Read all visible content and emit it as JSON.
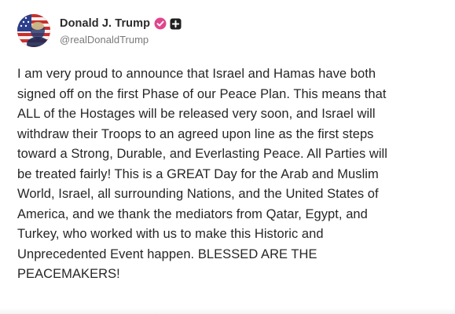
{
  "post": {
    "author": {
      "display_name": "Donald J. Trump",
      "handle": "@realDonaldTrump",
      "avatar_icon": "flag-portrait-avatar",
      "verified_icon": "verified-badge-icon",
      "verified_color": "#e0458f",
      "action_icon": "plus-square-icon"
    },
    "text_lines": [
      "I am very proud to announce that Israel and Hamas have both",
      "signed off on the first Phase of our Peace Plan. This means that",
      "ALL of the Hostages will be released very soon, and Israel will",
      "withdraw their Troops to an agreed upon line as the first steps",
      "toward a Strong, Durable, and Everlasting Peace. All Parties will",
      "be treated fairly! This is a GREAT Day for the Arab and Muslim",
      "World, Israel, all surrounding Nations, and the United States of",
      "America, and we thank the mediators from Qatar, Egypt, and",
      "Turkey, who worked with us to make this Historic and",
      "Unprecedented Event happen. BLESSED ARE THE",
      "PEACEMAKERS!"
    ]
  },
  "colors": {
    "text": "#262626",
    "handle": "#7a7a7a",
    "background": "#ffffff"
  }
}
